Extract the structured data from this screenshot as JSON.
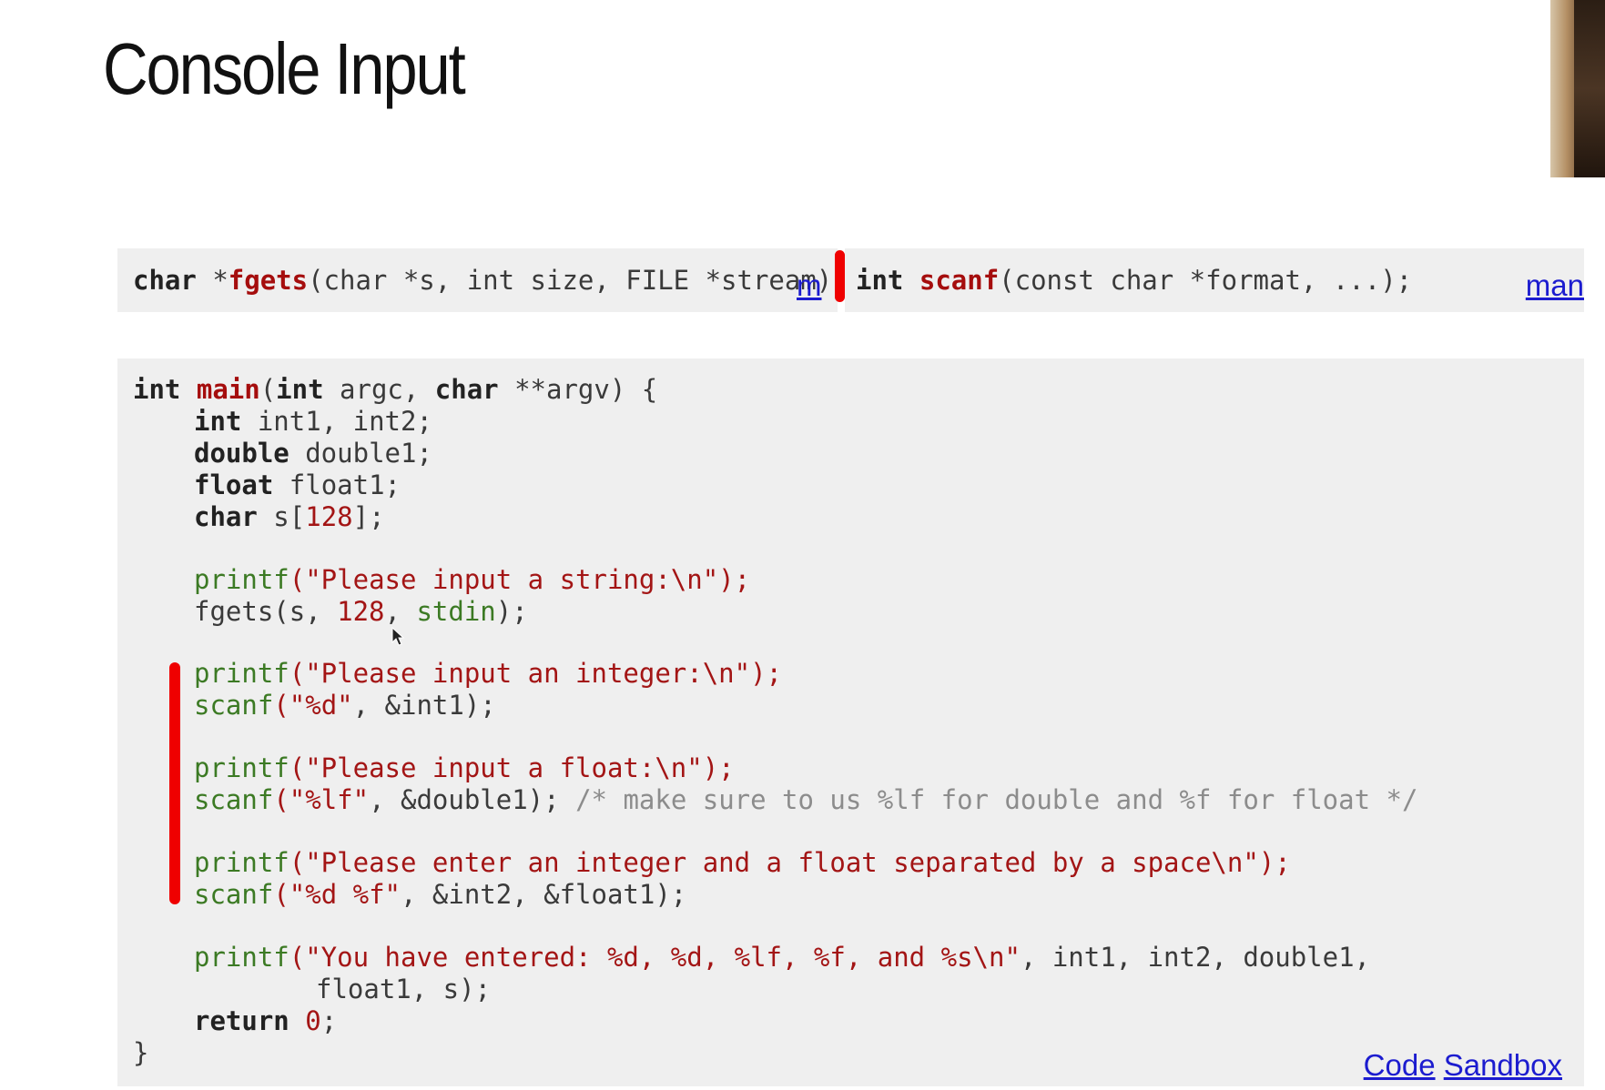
{
  "title": "Console Input",
  "signatures": {
    "fgets": {
      "type": "char",
      "star": "*",
      "name": "fgets",
      "params": "(char *s, int size, FILE *stream);",
      "link": "m"
    },
    "scanf": {
      "type": "int",
      "name": "scanf",
      "params": "(const char *format, ...);",
      "link": "man"
    }
  },
  "code": {
    "l1_kw": "int",
    "l1_fn": "main",
    "l1_open": "(",
    "l1_kw2": "int",
    "l1_mid": " argc, ",
    "l1_kw3": "char",
    "l1_end": " **argv) {",
    "l2_kw": "int",
    "l2_rest": " int1, int2;",
    "l3_kw": "double",
    "l3_rest": " double1;",
    "l4_kw": "float",
    "l4_rest": " float1;",
    "l5_kw": "char",
    "l5_rest": " s[",
    "l5_num": "128",
    "l5_end": "];",
    "l6_bi": "printf",
    "l6_str": "(\"Please input a string:\\n\");",
    "l7_a": "fgets(s, ",
    "l7_num": "128",
    "l7_b": ", ",
    "l7_bi": "stdin",
    "l7_end": ");",
    "l8_bi": "printf",
    "l8_str": "(\"Please input an integer:\\n\");",
    "l9_bi": "scanf",
    "l9_str": "(\"%d\"",
    "l9_end": ", &int1);",
    "l10_bi": "printf",
    "l10_str": "(\"Please input a float:\\n\");",
    "l11_bi": "scanf",
    "l11_str": "(\"%lf\"",
    "l11_mid": ", &double1); ",
    "l11_cm": "/* make sure to us %lf for double and %f for float */",
    "l12_bi": "printf",
    "l12_str": "(\"Please enter an integer and a float separated by a space\\n\");",
    "l13_bi": "scanf",
    "l13_str": "(\"%d %f\"",
    "l13_end": ", &int2, &float1);",
    "l14_bi": "printf",
    "l14_str": "(\"You have entered: %d, %d, %lf, %f, and %s\\n\"",
    "l14_end": ", int1, int2, double1,",
    "l15": "float1, s);",
    "l16_kw": "return",
    "l16_sp": " ",
    "l16_num": "0",
    "l16_end": ";",
    "l17": "}"
  },
  "links": {
    "code": "Code",
    "sandbox": "Sandbox"
  },
  "colors": {
    "highlight": "#ef0000",
    "link": "#1c1ccf",
    "code_bg": "#efefef"
  }
}
